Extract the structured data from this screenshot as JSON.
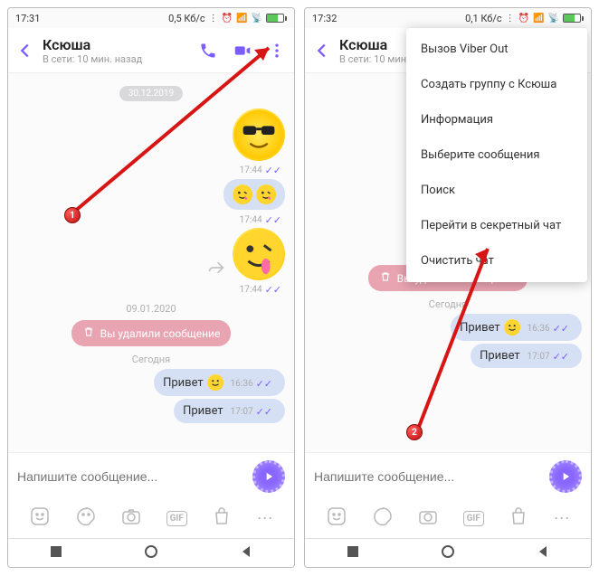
{
  "phone1": {
    "statusbar": {
      "time": "17:31",
      "net": "0,5 Кб/с"
    },
    "header": {
      "name": "Ксюша",
      "status": "В сети: 10 мин. назад"
    }
  },
  "phone2": {
    "statusbar": {
      "time": "17:32",
      "net": "0,1 Кб/с"
    },
    "header": {
      "name": "Ксюша",
      "status": "В сети: 10 мин. назад"
    },
    "menu": {
      "item1": "Вызов Viber Out",
      "item2": "Создать группу с Ксюша",
      "item3": "Информация",
      "item4": "Выберите сообщения",
      "item5": "Поиск",
      "item6": "Перейти в секретный чат",
      "item7": "Очистить чат"
    }
  },
  "chat": {
    "date1": "30.12.2019",
    "time1": "17:44",
    "time2": "17:44",
    "time3": "17:44",
    "date2": "09.01.2020",
    "deleted": "Вы удалили сообщение",
    "date3": "Сегодня",
    "msg_hello": "Привет",
    "time4": "16:36",
    "msg_hello2": "Привет",
    "time5": "17:07"
  },
  "input": {
    "placeholder": "Напишите сообщение..."
  },
  "toolbar": {
    "gif": "GIF"
  },
  "markers": {
    "m1": "1",
    "m2": "2"
  }
}
